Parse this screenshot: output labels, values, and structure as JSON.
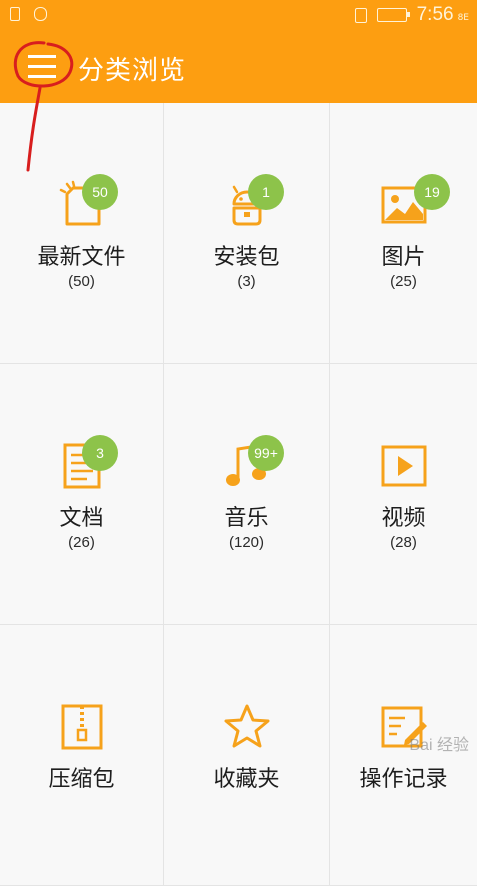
{
  "status_bar": {
    "time": "7:56",
    "network": "8E"
  },
  "app_bar": {
    "title": "分类浏览"
  },
  "categories": [
    {
      "name": "最新文件",
      "count": "(50)",
      "badge": "50",
      "icon": "new-file-icon"
    },
    {
      "name": "安装包",
      "count": "(3)",
      "badge": "1",
      "icon": "android-package-icon"
    },
    {
      "name": "图片",
      "count": "(25)",
      "badge": "19",
      "icon": "image-icon"
    },
    {
      "name": "文档",
      "count": "(26)",
      "badge": "3",
      "icon": "document-icon"
    },
    {
      "name": "音乐",
      "count": "(120)",
      "badge": "99+",
      "icon": "music-icon"
    },
    {
      "name": "视频",
      "count": "(28)",
      "badge": "",
      "icon": "video-icon"
    },
    {
      "name": "压缩包",
      "count": "",
      "badge": "",
      "icon": "zip-icon"
    },
    {
      "name": "收藏夹",
      "count": "",
      "badge": "",
      "icon": "star-icon"
    },
    {
      "name": "操作记录",
      "count": "",
      "badge": "",
      "icon": "history-icon"
    }
  ],
  "watermark": "Bai 经验",
  "colors": {
    "accent": "#fd9e11",
    "icon": "#f6a21b",
    "badge": "#8dc34a",
    "annotation": "#d81e1e"
  }
}
